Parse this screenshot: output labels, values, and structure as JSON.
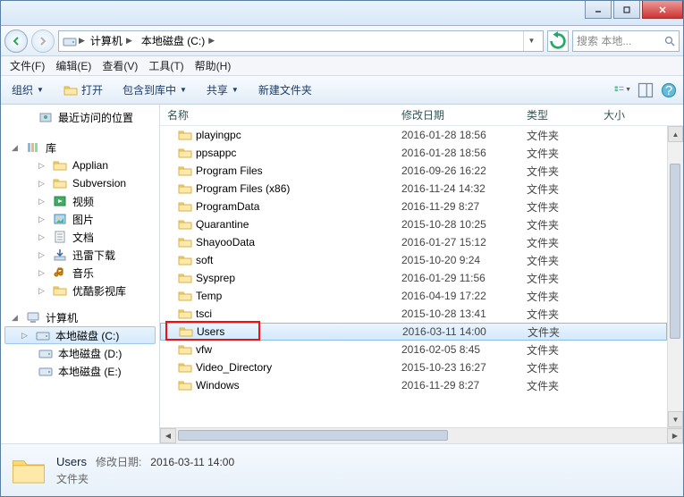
{
  "breadcrumb": {
    "root": "计算机",
    "drive": "本地磁盘 (C:)"
  },
  "search": {
    "placeholder": "搜索 本地..."
  },
  "menu": {
    "file": "文件(F)",
    "edit": "编辑(E)",
    "view": "查看(V)",
    "tools": "工具(T)",
    "help": "帮助(H)"
  },
  "toolbar": {
    "organize": "组织",
    "open": "打开",
    "include": "包含到库中",
    "share": "共享",
    "newfolder": "新建文件夹"
  },
  "sidebar": {
    "recent": "最近访问的位置",
    "libraries": "库",
    "lib_items": [
      "Applian",
      "Subversion",
      "视频",
      "图片",
      "文档",
      "迅雷下载",
      "音乐",
      "优酷影视库"
    ],
    "computer": "计算机",
    "drives": [
      "本地磁盘 (C:)",
      "本地磁盘 (D:)",
      "本地磁盘 (E:)"
    ]
  },
  "columns": {
    "name": "名称",
    "date": "修改日期",
    "type": "类型",
    "size": "大小"
  },
  "files": [
    {
      "name": "playingpc",
      "date": "2016-01-28 18:56",
      "type": "文件夹"
    },
    {
      "name": "ppsappc",
      "date": "2016-01-28 18:56",
      "type": "文件夹"
    },
    {
      "name": "Program Files",
      "date": "2016-09-26 16:22",
      "type": "文件夹"
    },
    {
      "name": "Program Files (x86)",
      "date": "2016-11-24 14:32",
      "type": "文件夹"
    },
    {
      "name": "ProgramData",
      "date": "2016-11-29 8:27",
      "type": "文件夹"
    },
    {
      "name": "Quarantine",
      "date": "2015-10-28 10:25",
      "type": "文件夹"
    },
    {
      "name": "ShayooData",
      "date": "2016-01-27 15:12",
      "type": "文件夹"
    },
    {
      "name": "soft",
      "date": "2015-10-20 9:24",
      "type": "文件夹"
    },
    {
      "name": "Sysprep",
      "date": "2016-01-29 11:56",
      "type": "文件夹"
    },
    {
      "name": "Temp",
      "date": "2016-04-19 17:22",
      "type": "文件夹"
    },
    {
      "name": "tsci",
      "date": "2015-10-28 13:41",
      "type": "文件夹"
    },
    {
      "name": "Users",
      "date": "2016-03-11 14:00",
      "type": "文件夹",
      "selected": true,
      "highlight": true
    },
    {
      "name": "vfw",
      "date": "2016-02-05 8:45",
      "type": "文件夹"
    },
    {
      "name": "Video_Directory",
      "date": "2015-10-23 16:27",
      "type": "文件夹"
    },
    {
      "name": "Windows",
      "date": "2016-11-29 8:27",
      "type": "文件夹"
    }
  ],
  "details": {
    "name": "Users",
    "mod_label": "修改日期:",
    "mod_value": "2016-03-11 14:00",
    "type": "文件夹"
  }
}
